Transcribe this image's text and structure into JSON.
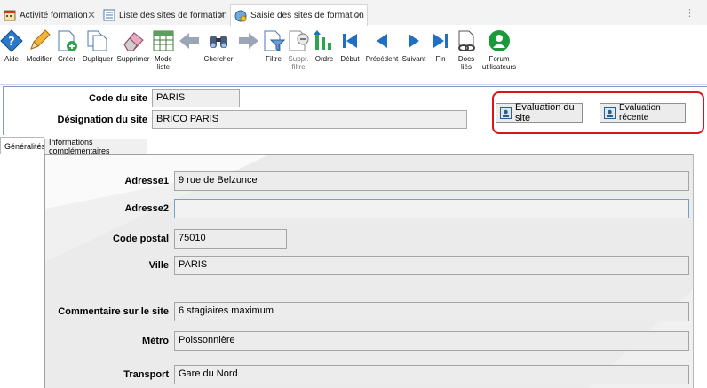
{
  "tabs": [
    {
      "label": "Activité formation",
      "icon": "calendar-icon",
      "active": false
    },
    {
      "label": "Liste des sites de formation",
      "icon": "list-icon",
      "active": false
    },
    {
      "label": "Saisie des sites de formation",
      "icon": "site-form-icon",
      "active": true
    }
  ],
  "toolbar": {
    "aide": "Aide",
    "modifier": "Modifier",
    "creer": "Créer",
    "dupliquer": "Dupliquer",
    "supprimer": "Supprimer",
    "mode_liste": "Mode liste",
    "chercher": "Chercher",
    "filtre": "Filtre",
    "suppr_filtre": "Suppr. filtre",
    "ordre": "Ordre",
    "debut": "Début",
    "precedent": "Précédent",
    "suivant": "Suivant",
    "fin": "Fin",
    "docs_lies": "Docs liés",
    "forum": "Forum utilisateurs"
  },
  "header": {
    "code_label": "Code du site",
    "code_value": "PARIS",
    "designation_label": "Désignation du site",
    "designation_value": "BRICO PARIS",
    "eval_button": "Evaluation du site",
    "eval_recent_button": "Evaluation récente"
  },
  "subtabs": {
    "generalites": "Généralités",
    "infos": "Informations complémentaires"
  },
  "form": {
    "adresse1_label": "Adresse1",
    "adresse1_value": "9 rue de Belzunce",
    "adresse2_label": "Adresse2",
    "adresse2_value": "",
    "cp_label": "Code postal",
    "cp_value": "75010",
    "ville_label": "Ville",
    "ville_value": "PARIS",
    "commentaire_label": "Commentaire sur le site",
    "commentaire_value": "6 stagiaires maximum",
    "metro_label": "Métro",
    "metro_value": "Poissonnière",
    "transport_label": "Transport",
    "transport_value": "Gare du Nord"
  },
  "colors": {
    "highlight_frame": "#d9141b",
    "toolbar_blue": "#1f6fc5",
    "forum_green": "#1a9a3a"
  }
}
